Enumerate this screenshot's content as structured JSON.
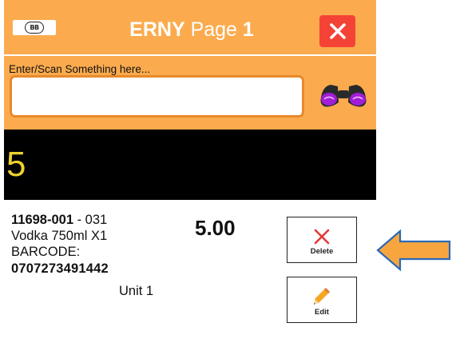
{
  "header": {
    "logo_text": "BB",
    "title_bold": "ERNY",
    "title_page": "Page",
    "title_number": "1"
  },
  "scan": {
    "label": "Enter/Scan Something here...",
    "value": "",
    "placeholder": ""
  },
  "count": "5",
  "item": {
    "code_bold": "11698-001",
    "code_suffix": " - 031",
    "name": "Vodka 750ml X1",
    "barcode_label": "BARCODE:",
    "barcode": "0707273491442",
    "unit": "Unit 1",
    "quantity": "5.00"
  },
  "actions": {
    "delete_label": "Delete",
    "edit_label": "Edit"
  },
  "colors": {
    "header_bg": "#fbab4e",
    "close_bg": "#f44336",
    "count_bg": "#000000",
    "count_text": "#ecd22c",
    "pointer_fill": "#f7a63f",
    "pointer_stroke": "#2a6ab8"
  }
}
